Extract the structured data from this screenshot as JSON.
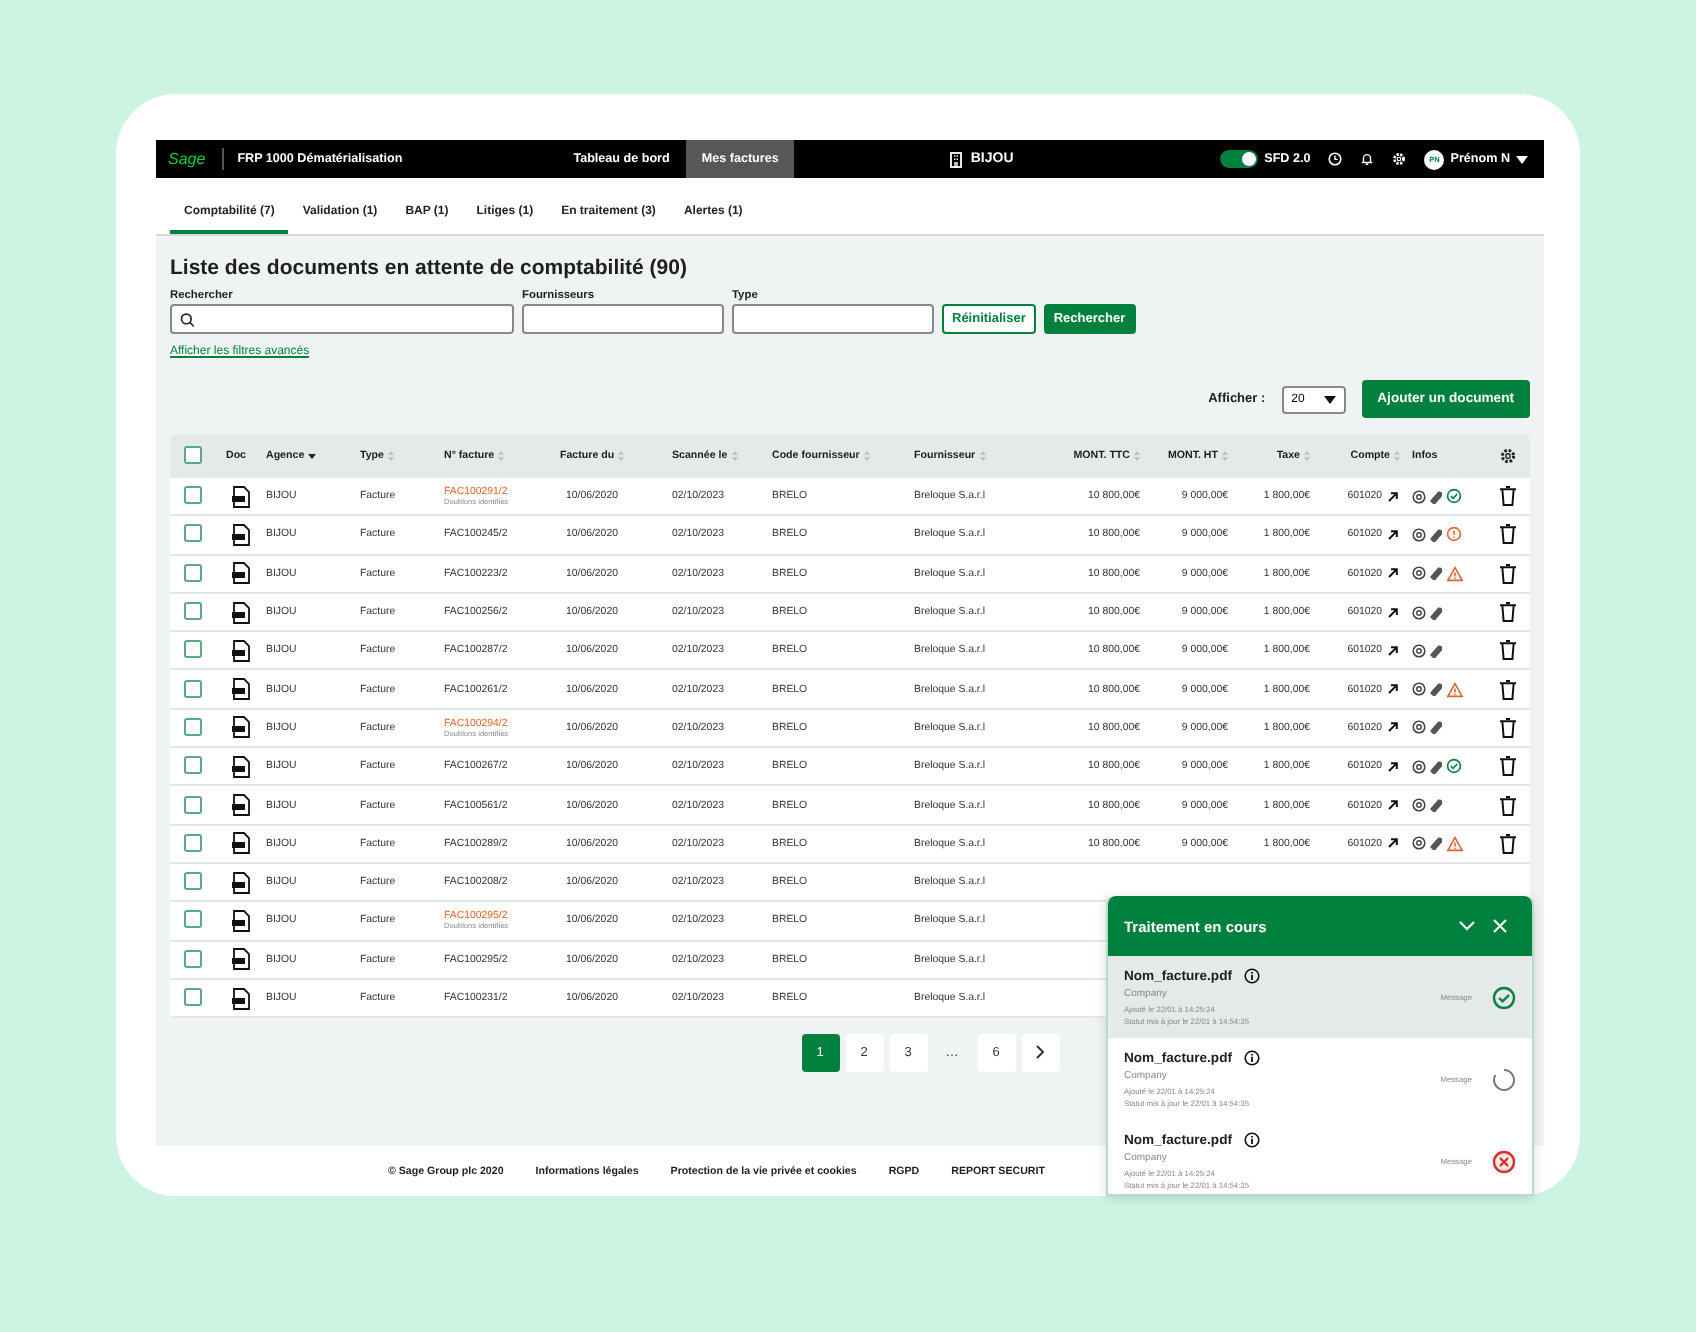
{
  "top_bar": {
    "logo": "Sage",
    "app_title": "FRP 1000 Dématérialisation",
    "nav": [
      {
        "label": "Tableau de bord",
        "selected": false
      },
      {
        "label": "Mes factures",
        "selected": true
      }
    ],
    "company": "BIJOU",
    "sfd_toggle": {
      "on": true,
      "label": "SFD 2.0"
    },
    "user": {
      "initials": "PN",
      "name": "Prénom N"
    }
  },
  "tabs": [
    {
      "label": "Comptabilité (7)",
      "selected": true
    },
    {
      "label": "Validation (1)",
      "selected": false
    },
    {
      "label": "BAP (1)",
      "selected": false
    },
    {
      "label": "Litiges (1)",
      "selected": false
    },
    {
      "label": "En traitement (3)",
      "selected": false
    },
    {
      "label": "Alertes (1)",
      "selected": false
    }
  ],
  "page_title": "Liste des documents en attente de comptabilité (90)",
  "filters": {
    "search_label": "Rechercher",
    "suppliers_label": "Fournisseurs",
    "type_label": "Type",
    "reset_button": "Réinitialiser",
    "search_button": "Rechercher",
    "advanced_link": "Afficher les filtres avancés"
  },
  "display": {
    "label": "Afficher :",
    "page_size": "20",
    "add_button": "Ajouter un document"
  },
  "table": {
    "header_checked": false,
    "columns": [
      {
        "label": "Doc",
        "kind": "plain"
      },
      {
        "label": "Agence",
        "kind": "sorted"
      },
      {
        "label": "Type",
        "kind": "sortable"
      },
      {
        "label": "N° facture",
        "kind": "sortable"
      },
      {
        "label": "Facture du",
        "kind": "sortable"
      },
      {
        "label": "Scannée le",
        "kind": "sortable"
      },
      {
        "label": "Code fournisseur",
        "kind": "sortable"
      },
      {
        "label": "Fournisseur",
        "kind": "sortable"
      },
      {
        "label": "MONT. TTC",
        "kind": "sortable"
      },
      {
        "label": "MONT. HT",
        "kind": "sortable"
      },
      {
        "label": "Taxe",
        "kind": "sortable"
      },
      {
        "label": "Compte",
        "kind": "sortable"
      },
      {
        "label": "Infos",
        "kind": "plain"
      }
    ],
    "rows": [
      {
        "checked": false,
        "agence": "BIJOU",
        "type": "Facture",
        "invoice": "FAC100291/2",
        "duplicate_note": "Doublons identifiés",
        "invoice_date": "10/06/2020",
        "scanned": "02/10/2023",
        "supplier_code": "BRELO",
        "supplier": "Breloque S.a.r.l",
        "ttc": "10 800,00€",
        "ht": "9 000,00€",
        "tax": "1 800,00€",
        "account": "601020",
        "kind": "ok"
      },
      {
        "checked": false,
        "agence": "BIJOU",
        "type": "Facture",
        "invoice": "FAC100245/2",
        "invoice_date": "10/06/2020",
        "scanned": "02/10/2023",
        "supplier_code": "BRELO",
        "supplier": "Breloque S.a.r.l",
        "ttc": "10 800,00€",
        "ht": "9 000,00€",
        "tax": "1 800,00€",
        "account": "601020",
        "kind": "error"
      },
      {
        "checked": false,
        "agence": "BIJOU",
        "type": "Facture",
        "invoice": "FAC100223/2",
        "invoice_date": "10/06/2020",
        "scanned": "02/10/2023",
        "supplier_code": "BRELO",
        "supplier": "Breloque S.a.r.l",
        "ttc": "10 800,00€",
        "ht": "9 000,00€",
        "tax": "1 800,00€",
        "account": "601020",
        "kind": "warning"
      },
      {
        "checked": false,
        "agence": "BIJOU",
        "type": "Facture",
        "invoice": "FAC100256/2",
        "invoice_date": "10/06/2020",
        "scanned": "02/10/2023",
        "supplier_code": "BRELO",
        "supplier": "Breloque S.a.r.l",
        "ttc": "10 800,00€",
        "ht": "9 000,00€",
        "tax": "1 800,00€",
        "account": "601020",
        "kind": "plain"
      },
      {
        "checked": false,
        "agence": "BIJOU",
        "type": "Facture",
        "invoice": "FAC100287/2",
        "invoice_date": "10/06/2020",
        "scanned": "02/10/2023",
        "supplier_code": "BRELO",
        "supplier": "Breloque S.a.r.l",
        "ttc": "10 800,00€",
        "ht": "9 000,00€",
        "tax": "1 800,00€",
        "account": "601020",
        "kind": "plain"
      },
      {
        "checked": false,
        "agence": "BIJOU",
        "type": "Facture",
        "invoice": "FAC100261/2",
        "invoice_date": "10/06/2020",
        "scanned": "02/10/2023",
        "supplier_code": "BRELO",
        "supplier": "Breloque S.a.r.l",
        "ttc": "10 800,00€",
        "ht": "9 000,00€",
        "tax": "1 800,00€",
        "account": "601020",
        "kind": "warning"
      },
      {
        "checked": false,
        "agence": "BIJOU",
        "type": "Facture",
        "invoice": "FAC100294/2",
        "duplicate_note": "Doublons identifiés",
        "invoice_date": "10/06/2020",
        "scanned": "02/10/2023",
        "supplier_code": "BRELO",
        "supplier": "Breloque S.a.r.l",
        "ttc": "10 800,00€",
        "ht": "9 000,00€",
        "tax": "1 800,00€",
        "account": "601020",
        "kind": "plain"
      },
      {
        "checked": false,
        "agence": "BIJOU",
        "type": "Facture",
        "invoice": "FAC100267/2",
        "invoice_date": "10/06/2020",
        "scanned": "02/10/2023",
        "supplier_code": "BRELO",
        "supplier": "Breloque S.a.r.l",
        "ttc": "10 800,00€",
        "ht": "9 000,00€",
        "tax": "1 800,00€",
        "account": "601020",
        "kind": "ok"
      },
      {
        "checked": false,
        "agence": "BIJOU",
        "type": "Facture",
        "invoice": "FAC100561/2",
        "invoice_date": "10/06/2020",
        "scanned": "02/10/2023",
        "supplier_code": "BRELO",
        "supplier": "Breloque S.a.r.l",
        "ttc": "10 800,00€",
        "ht": "9 000,00€",
        "tax": "1 800,00€",
        "account": "601020",
        "kind": "plain"
      },
      {
        "checked": false,
        "agence": "BIJOU",
        "type": "Facture",
        "invoice": "FAC100289/2",
        "invoice_date": "10/06/2020",
        "scanned": "02/10/2023",
        "supplier_code": "BRELO",
        "supplier": "Breloque S.a.r.l",
        "ttc": "10 800,00€",
        "ht": "9 000,00€",
        "tax": "1 800,00€",
        "account": "601020",
        "kind": "warning"
      },
      {
        "checked": false,
        "agence": "BIJOU",
        "type": "Facture",
        "invoice": "FAC100208/2",
        "invoice_date": "10/06/2020",
        "scanned": "02/10/2023",
        "supplier_code": "BRELO",
        "supplier": "Breloque S.a.r.l"
      },
      {
        "checked": false,
        "agence": "BIJOU",
        "type": "Facture",
        "invoice": "FAC100295/2",
        "duplicate_note": "Doublons identifiés",
        "invoice_date": "10/06/2020",
        "scanned": "02/10/2023",
        "supplier_code": "BRELO",
        "supplier": "Breloque S.a.r.l"
      },
      {
        "checked": false,
        "agence": "BIJOU",
        "type": "Facture",
        "invoice": "FAC100295/2",
        "invoice_date": "10/06/2020",
        "scanned": "02/10/2023",
        "supplier_code": "BRELO",
        "supplier": "Breloque S.a.r.l"
      },
      {
        "checked": false,
        "agence": "BIJOU",
        "type": "Facture",
        "invoice": "FAC100231/2",
        "invoice_date": "10/06/2020",
        "scanned": "02/10/2023",
        "supplier_code": "BRELO",
        "supplier": "Breloque S.a.r.l"
      }
    ]
  },
  "pagination": {
    "pages": [
      {
        "label": "1",
        "selected": true
      },
      {
        "label": "2",
        "selected": false
      },
      {
        "label": "3",
        "selected": false
      }
    ],
    "ellipsis": "…",
    "last_pages": [
      {
        "label": "6",
        "selected": false
      }
    ]
  },
  "footer": [
    "© Sage Group plc 2020",
    "Informations légales",
    "Protection de la vie privée et cookies",
    "RGPD",
    "REPORT SECURIT"
  ],
  "processing_panel": {
    "title": "Traitement en cours",
    "items": [
      {
        "file": "Nom_facture.pdf",
        "company": "Company",
        "added": "Ajouté le 22/01 à 14:25:24",
        "updated": "Statut mis à jour le 22/01 à 14:54:35",
        "message": "Message",
        "kind": "done",
        "selected": true
      },
      {
        "file": "Nom_facture.pdf",
        "company": "Company",
        "added": "Ajouté le 22/01 à 14:25:24",
        "updated": "Statut mis à jour le 22/01 à 14:54:35",
        "message": "Message",
        "kind": "loading",
        "selected": false
      },
      {
        "file": "Nom_facture.pdf",
        "company": "Company",
        "added": "Ajouté le 22/01 à 14:25:24",
        "updated": "Statut mis à jour le 22/01 à 14:54:35",
        "message": "Message",
        "kind": "failed",
        "selected": false
      }
    ]
  }
}
